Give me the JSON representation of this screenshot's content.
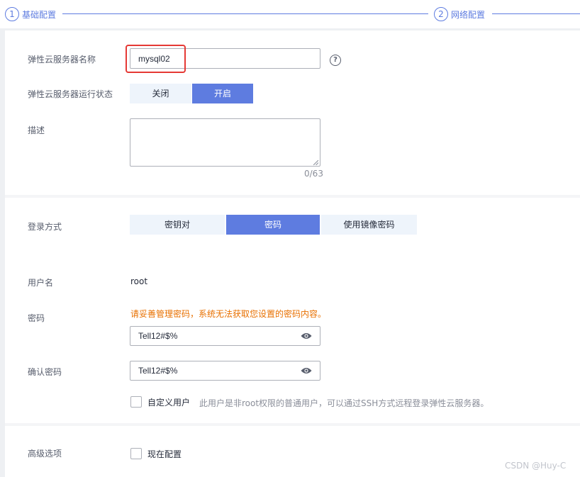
{
  "steps": [
    {
      "num": "1",
      "label": "基础配置"
    },
    {
      "num": "2",
      "label": "网络配置"
    }
  ],
  "form": {
    "name_label": "弹性云服务器名称",
    "name_value": "mysql02",
    "help_icon": "?",
    "status_label": "弹性云服务器运行状态",
    "status_options": [
      "关闭",
      "开启"
    ],
    "status_selected": "开启",
    "desc_label": "描述",
    "desc_value": "",
    "desc_counter": "0/63",
    "login_label": "登录方式",
    "login_options": [
      "密钥对",
      "密码",
      "使用镜像密码"
    ],
    "login_selected": "密码",
    "username_label": "用户名",
    "username_value": "root",
    "password_label": "密码",
    "password_warning": "请妥善管理密码，系统无法获取您设置的密码内容。",
    "password_value": "Tell12#$%",
    "confirm_label": "确认密码",
    "confirm_value": "Tell12#$%",
    "custom_user_label": "自定义用户",
    "custom_user_note": "此用户是非root权限的普通用户，可以通过SSH方式远程登录弹性云服务器。",
    "advanced_label": "高级选项",
    "advanced_check_label": "现在配置"
  },
  "watermark": "CSDN @Huy-C",
  "colors": {
    "accent": "#5e7ce0",
    "warning": "#e87000",
    "highlight": "#e53935",
    "segment_bg": "#eef4fb"
  }
}
